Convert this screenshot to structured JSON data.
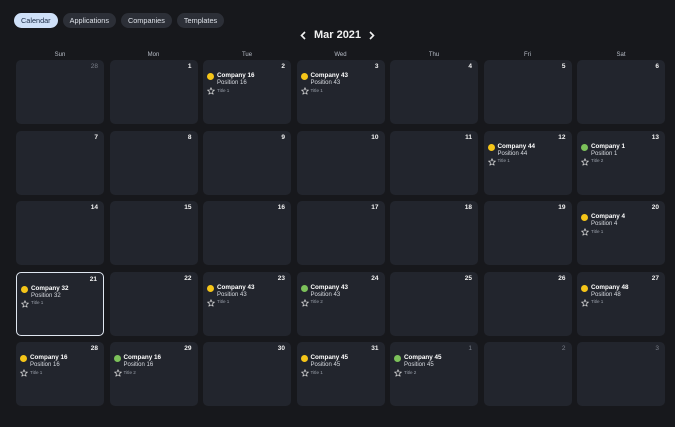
{
  "tabs": [
    {
      "label": "Calendar",
      "active": true
    },
    {
      "label": "Applications",
      "active": false
    },
    {
      "label": "Companies",
      "active": false
    },
    {
      "label": "Templates",
      "active": false
    }
  ],
  "header": {
    "month_label": "Mar 2021"
  },
  "weekdays": [
    "Sun",
    "Mon",
    "Tue",
    "Wed",
    "Thu",
    "Fri",
    "Sat"
  ],
  "status_colors": {
    "yellow": "#f5c518",
    "green": "#7cc15a"
  },
  "weeks": [
    [
      {
        "day": "28",
        "other": true
      },
      {
        "day": "1"
      },
      {
        "day": "2",
        "event": {
          "company": "Company 16",
          "position": "Position 16",
          "title": "Title 1",
          "status": "yellow"
        }
      },
      {
        "day": "3",
        "event": {
          "company": "Company 43",
          "position": "Position 43",
          "title": "Title 1",
          "status": "yellow"
        }
      },
      {
        "day": "4"
      },
      {
        "day": "5"
      },
      {
        "day": "6"
      }
    ],
    [
      {
        "day": "7"
      },
      {
        "day": "8"
      },
      {
        "day": "9"
      },
      {
        "day": "10"
      },
      {
        "day": "11"
      },
      {
        "day": "12",
        "event": {
          "company": "Company 44",
          "position": "Position 44",
          "title": "Title 1",
          "status": "yellow"
        }
      },
      {
        "day": "13",
        "event": {
          "company": "Company 1",
          "position": "Position 1",
          "title": "Title 2",
          "status": "green"
        }
      }
    ],
    [
      {
        "day": "14"
      },
      {
        "day": "15"
      },
      {
        "day": "16"
      },
      {
        "day": "17"
      },
      {
        "day": "18"
      },
      {
        "day": "19"
      },
      {
        "day": "20",
        "event": {
          "company": "Company 4",
          "position": "Position 4",
          "title": "Title 1",
          "status": "yellow"
        }
      }
    ],
    [
      {
        "day": "21",
        "today": true,
        "event": {
          "company": "Company 32",
          "position": "Position 32",
          "title": "Title 1",
          "status": "yellow"
        }
      },
      {
        "day": "22"
      },
      {
        "day": "23",
        "event": {
          "company": "Company 43",
          "position": "Position 43",
          "title": "Title 1",
          "status": "yellow"
        }
      },
      {
        "day": "24",
        "event": {
          "company": "Company 43",
          "position": "Position 43",
          "title": "Title 2",
          "status": "green"
        }
      },
      {
        "day": "25"
      },
      {
        "day": "26"
      },
      {
        "day": "27",
        "event": {
          "company": "Company 48",
          "position": "Position 48",
          "title": "Title 1",
          "status": "yellow"
        }
      }
    ],
    [
      {
        "day": "28",
        "event": {
          "company": "Company 16",
          "position": "Position 16",
          "title": "Title 1",
          "status": "yellow"
        }
      },
      {
        "day": "29",
        "event": {
          "company": "Company 16",
          "position": "Position 16",
          "title": "Title 2",
          "status": "green"
        }
      },
      {
        "day": "30"
      },
      {
        "day": "31",
        "event": {
          "company": "Company 45",
          "position": "Position 45",
          "title": "Title 1",
          "status": "yellow"
        }
      },
      {
        "day": "1",
        "other": true,
        "event": {
          "company": "Company 45",
          "position": "Position 45",
          "title": "Title 2",
          "status": "green"
        }
      },
      {
        "day": "2",
        "other": true
      },
      {
        "day": "3",
        "other": true
      }
    ]
  ]
}
